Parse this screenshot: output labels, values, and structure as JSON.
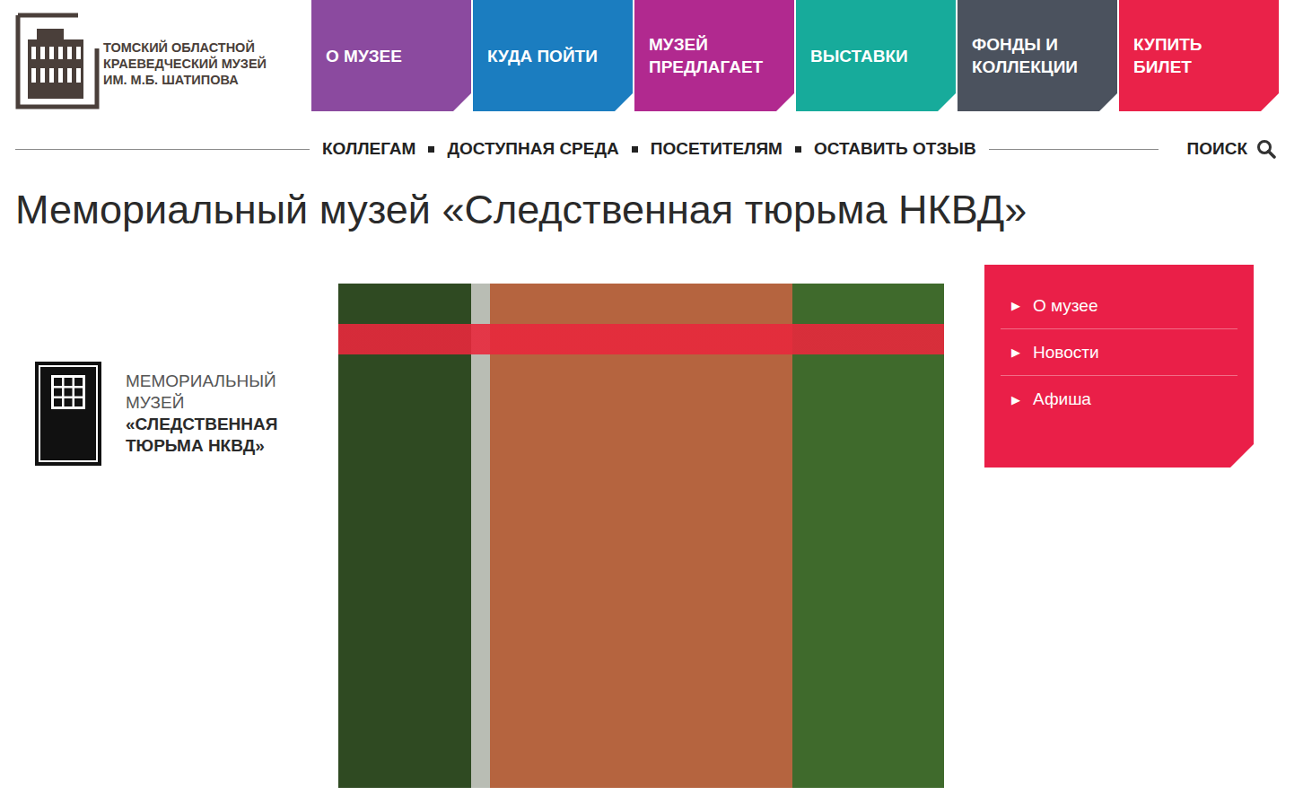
{
  "header": {
    "logo": {
      "lines": [
        "ТОМСКИЙ ОБЛАСТНОЙ",
        "КРАЕВЕДЧЕСКИЙ МУЗЕЙ",
        "ИМ. М.Б. ШАТИПОВА"
      ]
    }
  },
  "nav": [
    {
      "lines": [
        "О МУЗЕЕ"
      ],
      "color": "#8b4a9f"
    },
    {
      "lines": [
        "КУДА ПОЙТИ"
      ],
      "color": "#1b7dc0"
    },
    {
      "lines": [
        "МУЗЕЙ",
        "ПРЕДЛАГАЕТ"
      ],
      "color": "#b1298f"
    },
    {
      "lines": [
        "ВЫСТАВКИ"
      ],
      "color": "#17ab9b"
    },
    {
      "lines": [
        "ФОНДЫ И",
        "КОЛЛЕКЦИИ"
      ],
      "color": "#4b525e"
    },
    {
      "lines": [
        "КУПИТЬ",
        "БИЛЕТ"
      ],
      "color": "#ea2249"
    }
  ],
  "subnav": {
    "items": [
      "КОЛЛЕГАМ",
      "ДОСТУПНАЯ СРЕДА",
      "ПОСЕТИТЕЛЯМ",
      "ОСТАВИТЬ ОТЗЫВ"
    ],
    "search": "ПОИСК"
  },
  "page": {
    "title": "Мемориальный музей «Следственная тюрьма НКВД»"
  },
  "museum_logo": {
    "lines": [
      {
        "text": "МЕМОРИАЛЬНЫЙ",
        "kind": "light"
      },
      {
        "text": "МУЗЕЙ",
        "kind": "light"
      },
      {
        "text": "«СЛЕДСТВЕННАЯ",
        "kind": "bold"
      },
      {
        "text": "ТЮРЬМА НКВД»",
        "kind": "bold"
      }
    ]
  },
  "side_menu": {
    "items": [
      {
        "arrow": "▶",
        "label": "О музее"
      },
      {
        "arrow": "▶",
        "label": "Новости"
      },
      {
        "arrow": "▶",
        "label": "Афиша"
      }
    ]
  }
}
